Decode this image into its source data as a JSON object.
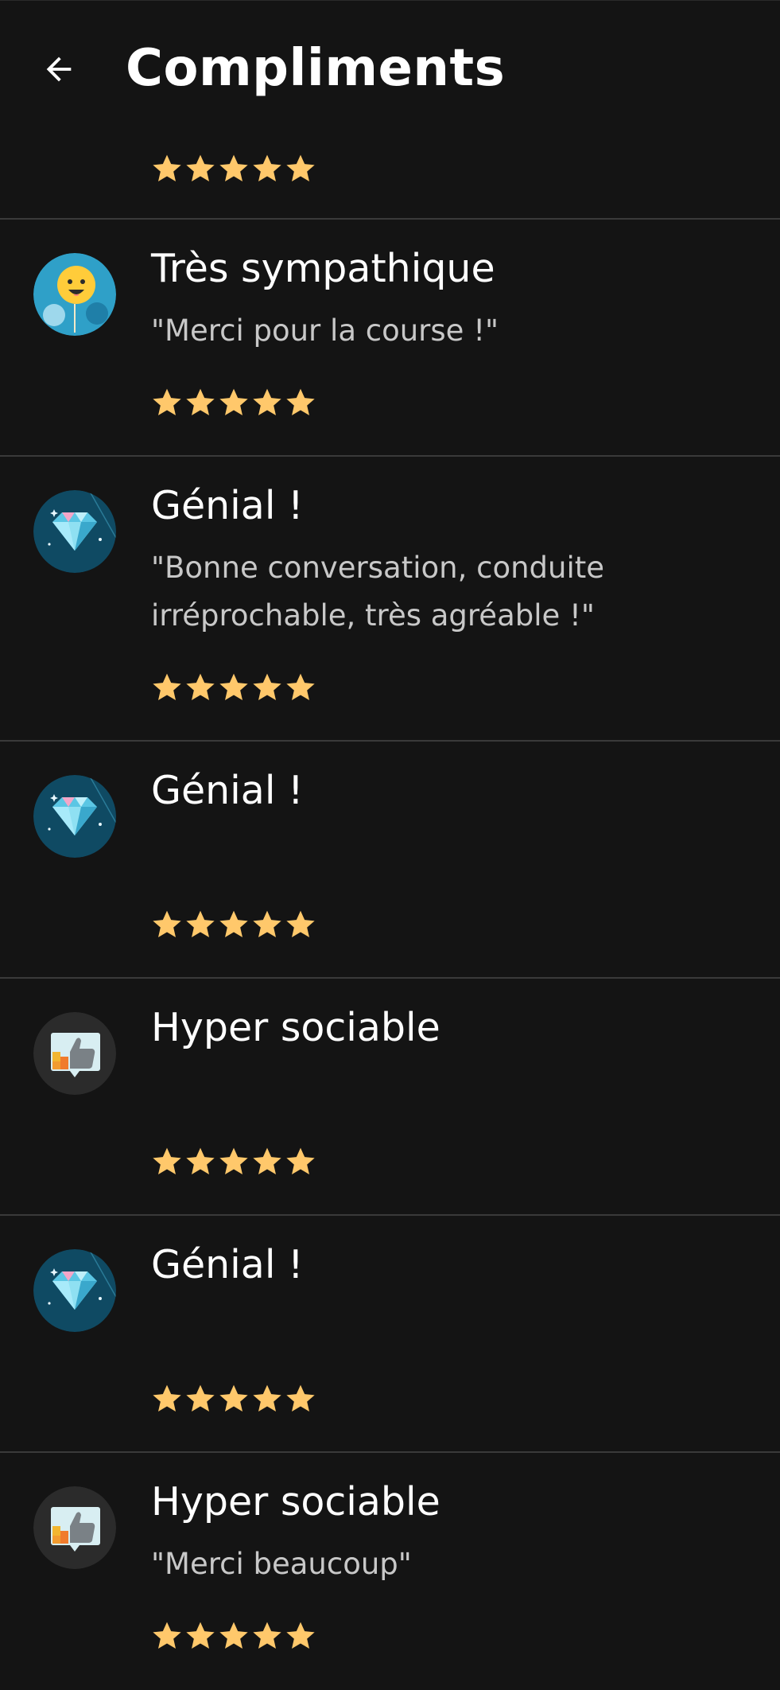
{
  "header": {
    "title": "Compliments",
    "back_icon": "arrow-left-icon"
  },
  "colors": {
    "background": "#141414",
    "star": "#ffc86b",
    "divider": "#3a3a3a",
    "muted_text": "#c8c8c8"
  },
  "compliments": [
    {
      "badge": "none",
      "title": "",
      "message": "",
      "rating": 5
    },
    {
      "badge": "smiley-balloon-icon",
      "title": "Très sympathique",
      "message": "\"Merci pour la course !\"",
      "rating": 5
    },
    {
      "badge": "diamond-icon",
      "title": "Génial !",
      "message": "\"Bonne conversation, conduite irréprochable, très agréable !\"",
      "rating": 5
    },
    {
      "badge": "diamond-icon",
      "title": "Génial !",
      "message": "",
      "rating": 5
    },
    {
      "badge": "thumbs-up-icon",
      "title": "Hyper sociable",
      "message": "",
      "rating": 5
    },
    {
      "badge": "diamond-icon",
      "title": "Génial !",
      "message": "",
      "rating": 5
    },
    {
      "badge": "thumbs-up-icon",
      "title": "Hyper sociable",
      "message": "\"Merci beaucoup\"",
      "rating": 5
    }
  ]
}
